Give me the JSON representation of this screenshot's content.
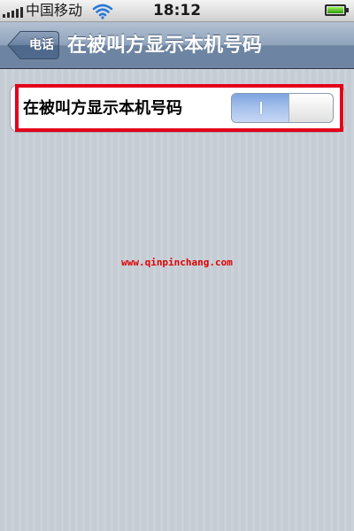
{
  "status_bar": {
    "carrier": "中国移动",
    "time": "18:12",
    "icons": {
      "signal": "signal-bars-icon",
      "wifi": "wifi-icon",
      "battery": "battery-icon"
    }
  },
  "nav_bar": {
    "back_label": "电话",
    "title": "在被叫方显示本机号码"
  },
  "settings_group": {
    "cell_label": "在被叫方显示本机号码",
    "toggle": {
      "state": "on",
      "on_symbol": "I"
    }
  },
  "annotation": {
    "color": "#e4001b"
  },
  "watermark": {
    "text": "www.qinpinchang.com"
  },
  "colors": {
    "nav_bar": "#6d84a2",
    "toggle_on": "#7ea4e0",
    "background": "#c5ccd4"
  }
}
